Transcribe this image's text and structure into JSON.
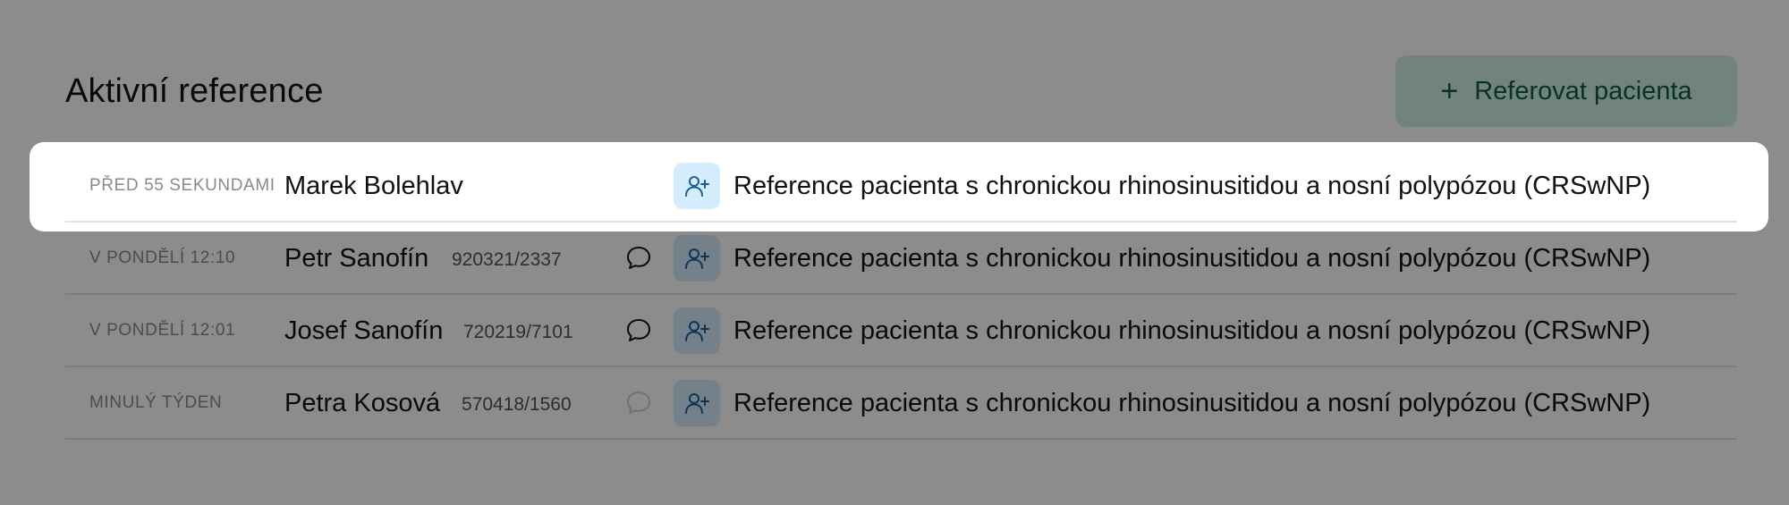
{
  "page": {
    "title": "Aktivní reference",
    "add_button_label": "Referovat pacienta",
    "add_button_icon": "plus-icon"
  },
  "highlighted_row": {
    "time": "Před 55 sekundami",
    "name": "Marek Bolehlav",
    "rc": "",
    "has_comment": false,
    "description": "Reference pacienta s chronickou rhinosinusitidou a nosní polypózou (CRSwNP)"
  },
  "rows": [
    {
      "time": "V pondělí 12:10",
      "name": "Petr Sanofín",
      "rc": "920321/2337",
      "comment_state": "active",
      "description": "Reference pacienta s chronickou rhinosinusitidou a nosní polypózou (CRSwNP)"
    },
    {
      "time": "V pondělí 12:01",
      "name": "Josef Sanofín",
      "rc": "720219/7101",
      "comment_state": "active",
      "description": "Reference pacienta s chronickou rhinosinusitidou a nosní polypózou (CRSwNP)"
    },
    {
      "time": "Minulý týden",
      "name": "Petra Kosová",
      "rc": "570418/1560",
      "comment_state": "muted",
      "description": "Reference pacienta s chronickou rhinosinusitidou a nosní polypózou (CRSwNP)"
    }
  ],
  "colors": {
    "overlay": "rgba(0,0,0,0.45)",
    "button_bg": "#cfeee0",
    "button_text": "#0d5c43",
    "type_icon_bg": "#d4ecfb",
    "type_icon_stroke": "#1b5f93"
  },
  "icons": {
    "comment": "speech-bubble-icon",
    "type": "user-plus-icon"
  }
}
